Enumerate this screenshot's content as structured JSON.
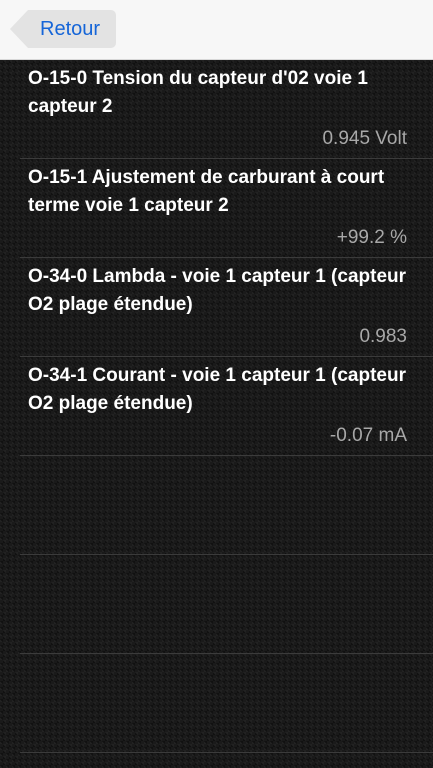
{
  "nav": {
    "back_label": "Retour"
  },
  "rows": [
    {
      "title": "O-15-0 Tension du capteur d'02 voie 1 capteur 2",
      "value": "0.945 Volt"
    },
    {
      "title": "O-15-1 Ajustement de carburant à court terme voie 1 capteur 2",
      "value": "+99.2 %"
    },
    {
      "title": "O-34-0 Lambda - voie 1 capteur 1 (capteur O2 plage étendue)",
      "value": "0.983"
    },
    {
      "title": "O-34-1 Courant - voie 1 capteur 1 (capteur O2 plage étendue)",
      "value": "-0.07 mA"
    }
  ],
  "colors": {
    "accent": "#1565d8",
    "background": "#1a1a1a",
    "title_text": "#ffffff",
    "value_text": "#a8a8a8"
  }
}
